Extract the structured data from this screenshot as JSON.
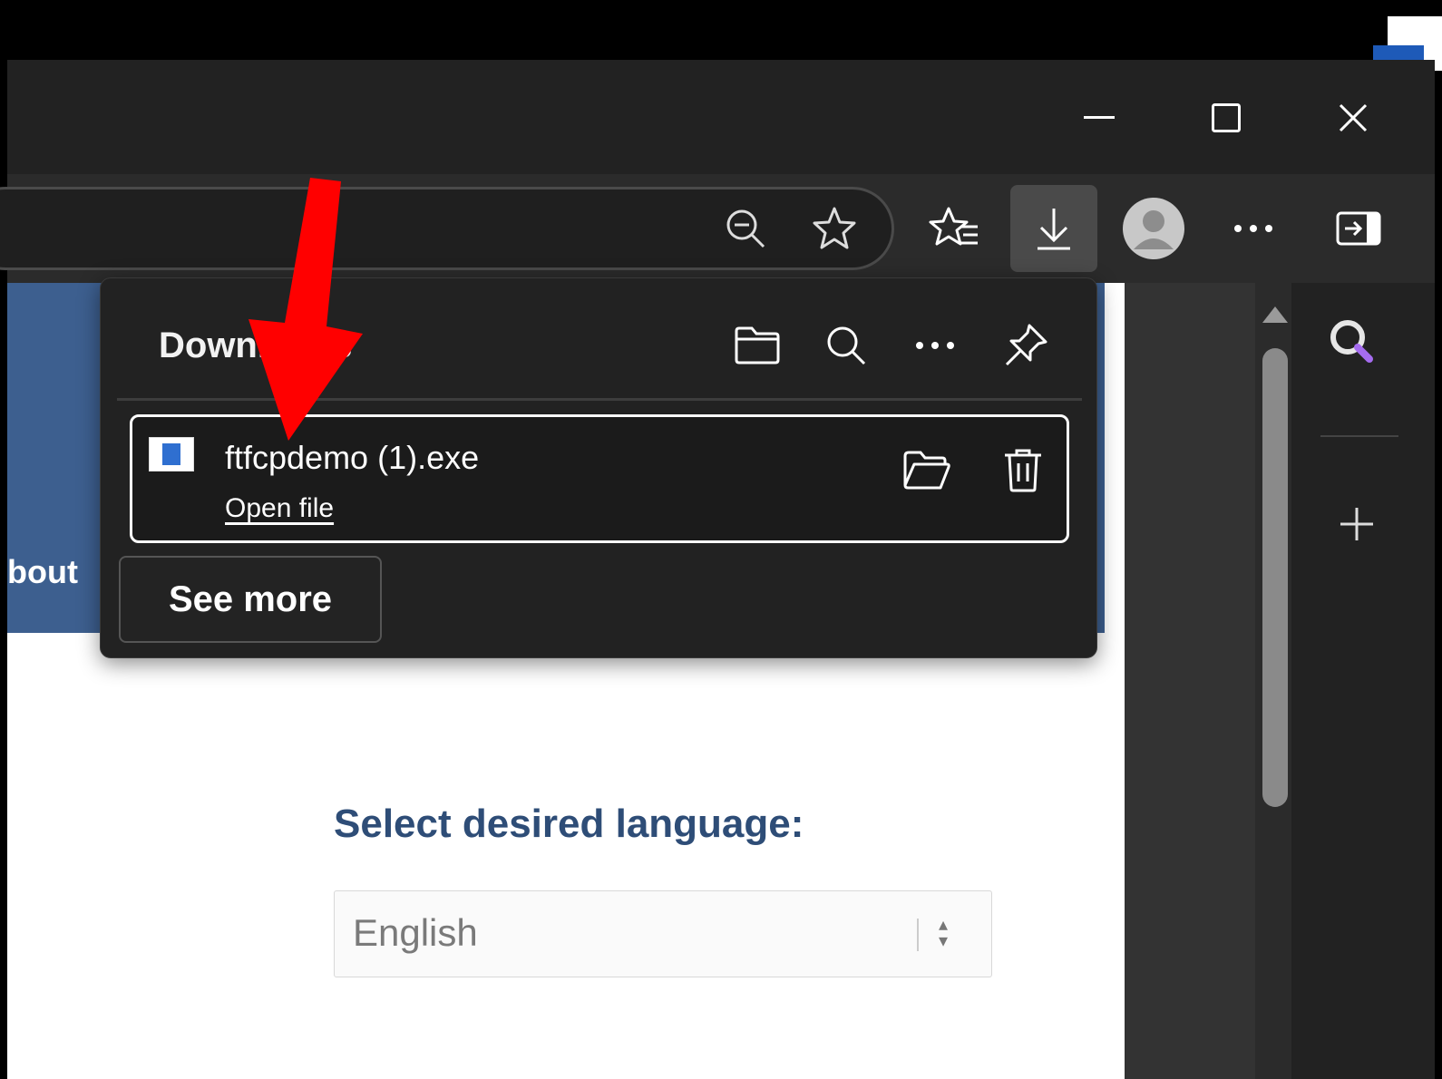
{
  "window": {
    "controls": [
      "minimize-icon",
      "maximize-icon",
      "close-icon"
    ]
  },
  "toolbar": {
    "icons": [
      "zoom-out-icon",
      "favorite-star-icon",
      "favorites-list-icon",
      "download-icon",
      "profile-avatar-icon",
      "more-options-icon",
      "sidebar-toggle-icon"
    ]
  },
  "page": {
    "banner_text": "bout",
    "language_title": "Select desired language:",
    "language_value": "English"
  },
  "downloads": {
    "title": "Downloads",
    "item": {
      "file_name": "ftfcpdemo (1).exe",
      "open_label": "Open file"
    },
    "see_more_label": "See more"
  },
  "sidebar": {
    "icons": [
      "search-icon",
      "add-icon"
    ]
  },
  "colors": {
    "annotation_arrow": "#ff0000",
    "banner": "#3d5f8f",
    "language_title": "#2e4d77"
  }
}
